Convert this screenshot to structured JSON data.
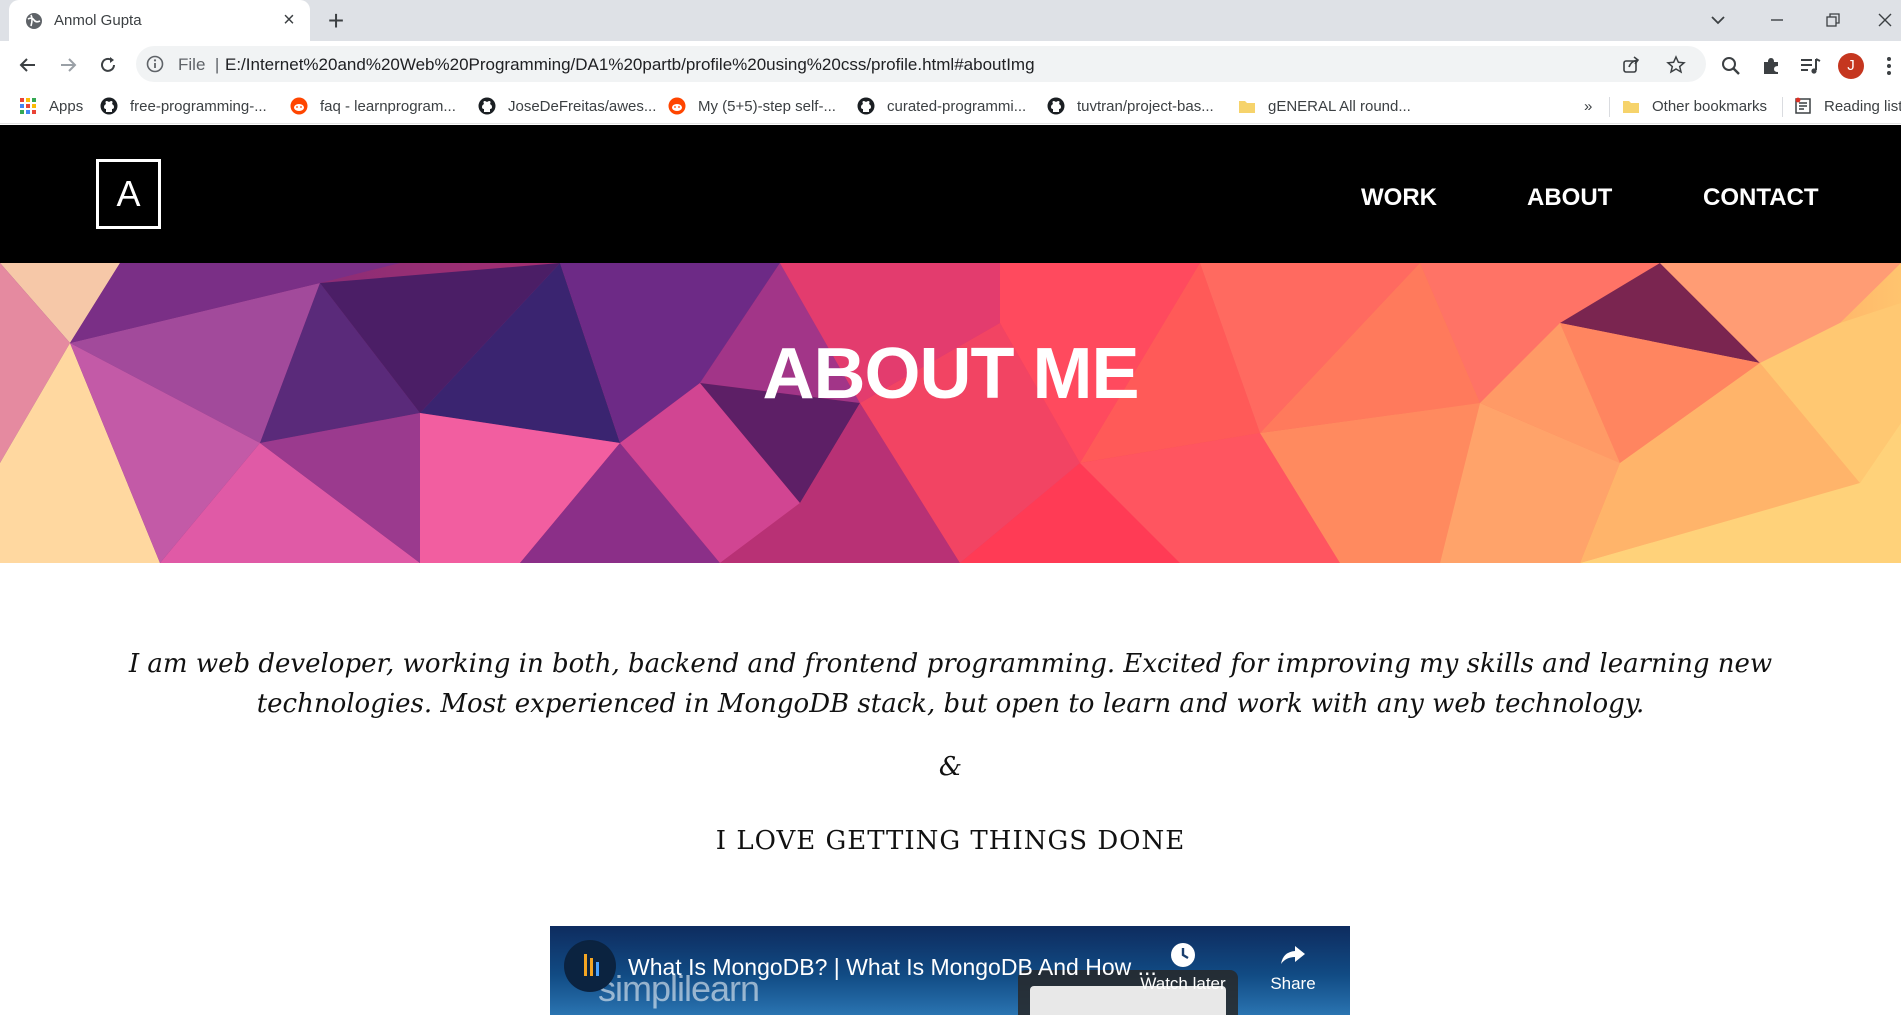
{
  "browser": {
    "tab": {
      "title": "Anmol Gupta",
      "close_icon": "×"
    },
    "new_tab_label": "+",
    "address": {
      "scheme_label": "File",
      "url": "E:/Internet%20and%20Web%20Programming/DA1%20partb/profile%20using%20css/profile.html#aboutImg"
    },
    "profile_initial": "J",
    "bookmarks": [
      {
        "label": "Apps",
        "icon": "apps-grid-icon"
      },
      {
        "label": "free-programming-...",
        "icon": "github-icon"
      },
      {
        "label": "faq - learnprogram...",
        "icon": "reddit-icon"
      },
      {
        "label": "JoseDeFreitas/awes...",
        "icon": "github-icon"
      },
      {
        "label": "My (5+5)-step self-...",
        "icon": "reddit-icon"
      },
      {
        "label": "curated-programmi...",
        "icon": "github-icon"
      },
      {
        "label": "tuvtran/project-bas...",
        "icon": "github-icon"
      },
      {
        "label": "gENERAL All round...",
        "icon": "folder-icon"
      }
    ],
    "more_bookmarks": "»",
    "other_bookmarks": "Other bookmarks",
    "reading_list": "Reading list"
  },
  "site": {
    "logo_letter": "A",
    "nav": {
      "work": "WORK",
      "about": "ABOUT",
      "contact": "CONTACT"
    },
    "hero_title": "ABOUT ME",
    "about_paragraph": "I am web developer, working in both, backend and frontend programming. Excited for improving my skills and learning new technologies. Most experienced in MongoDB stack, but open to learn and work with any web technology.",
    "ampersand": "&",
    "tagline": "I LOVE GETTING THINGS DONE",
    "video": {
      "title": "What Is MongoDB? | What Is MongoDB And How ...",
      "watermark": "simplilearn",
      "watch_later": "Watch later",
      "share": "Share"
    }
  },
  "colors": {
    "header_bg": "#000000",
    "hero_pink": "#f03a5f",
    "hero_purple": "#5b1f6b",
    "hero_orange": "#ffa062",
    "avatar": "#c5361f"
  }
}
